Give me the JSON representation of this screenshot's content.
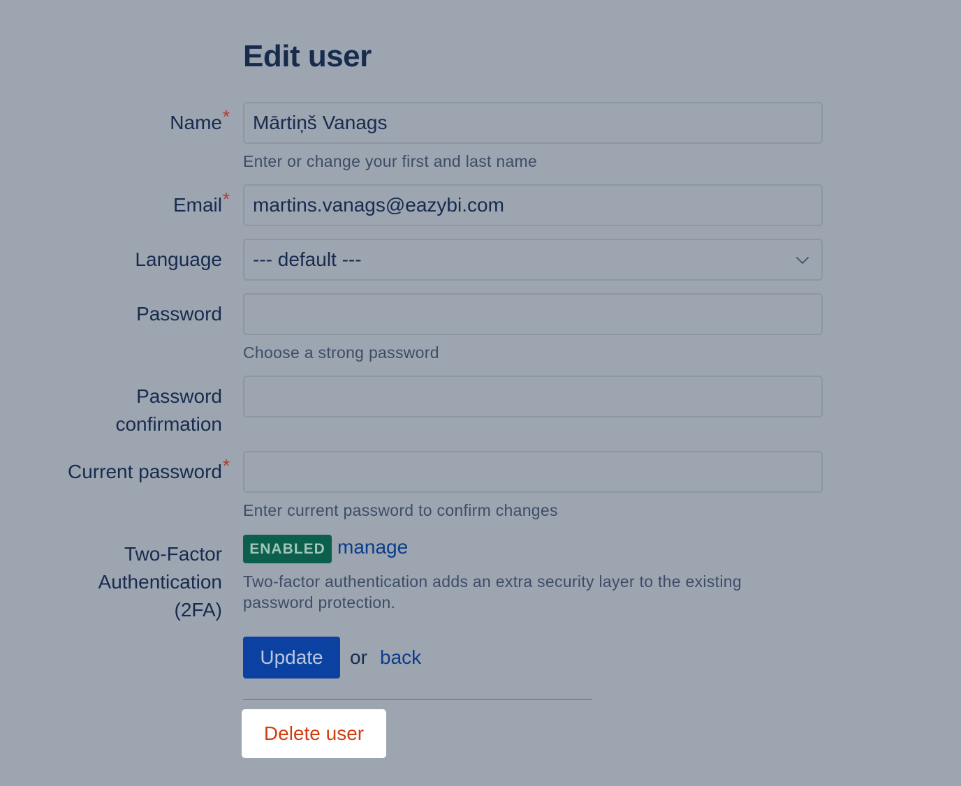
{
  "page": {
    "title": "Edit user"
  },
  "form": {
    "name": {
      "label": "Name",
      "required_mark": "*",
      "value": "Mārtiņš Vanags",
      "help": "Enter or change your first and last name"
    },
    "email": {
      "label": "Email",
      "required_mark": "*",
      "value": "martins.vanags@eazybi.com"
    },
    "language": {
      "label": "Language",
      "selected": "--- default ---"
    },
    "password": {
      "label": "Password",
      "value": "",
      "help": "Choose a strong password"
    },
    "password_confirmation": {
      "label_line1": "Password",
      "label_line2": "confirmation",
      "value": ""
    },
    "current_password": {
      "label": "Current password",
      "required_mark": "*",
      "value": "",
      "help": "Enter current password to confirm changes"
    },
    "two_factor": {
      "label_line1": "Two-Factor",
      "label_line2": "Authentication",
      "label_line3": "(2FA)",
      "status_badge": "ENABLED",
      "manage_link": "manage",
      "help_line1": "Two-factor authentication adds an extra security layer to the existing",
      "help_line2": "password protection."
    }
  },
  "actions": {
    "update_label": "Update",
    "or_text": "or",
    "back_link": "back",
    "delete_label": "Delete user"
  },
  "colors": {
    "background": "#9da5b1",
    "text": "#172b4d",
    "link": "#0b3d8a",
    "primary_button": "#0b41a0",
    "badge": "#0c5f4d",
    "danger_text": "#d13d11",
    "required": "#b03a2e"
  },
  "icons": {
    "language_select": "chevron-down-icon"
  }
}
